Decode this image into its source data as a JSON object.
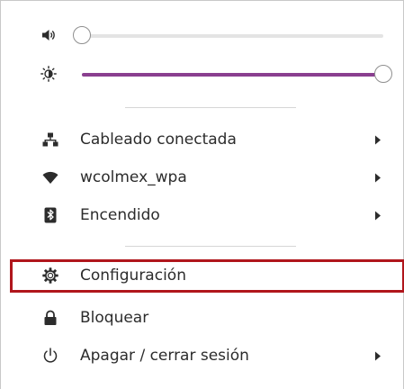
{
  "sliders": {
    "volume": {
      "icon": "speaker-volume-icon",
      "level": 0
    },
    "brightness": {
      "icon": "brightness-icon",
      "level": 1.0,
      "accent": "#8a3f8f"
    }
  },
  "network_items": [
    {
      "icon": "wired-network-icon",
      "label": "Cableado conectada",
      "has_submenu": true
    },
    {
      "icon": "wifi-icon",
      "label": "wcolmex_wpa",
      "has_submenu": true
    },
    {
      "icon": "bluetooth-icon",
      "label": "Encendido",
      "has_submenu": true
    }
  ],
  "system_items": [
    {
      "icon": "gear-icon",
      "label": "Configuración",
      "has_submenu": false,
      "highlighted": true
    },
    {
      "icon": "lock-icon",
      "label": "Bloquear",
      "has_submenu": false
    },
    {
      "icon": "power-icon",
      "label": "Apagar / cerrar sesión",
      "has_submenu": true
    }
  ],
  "highlight_color": "#b0161c"
}
